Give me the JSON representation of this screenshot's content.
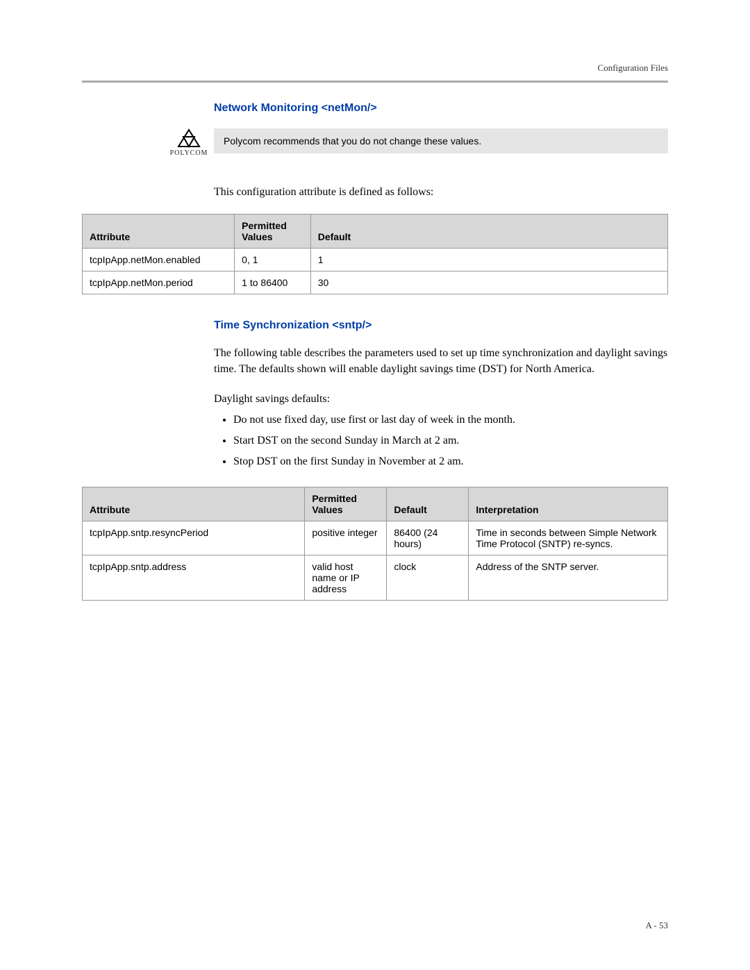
{
  "header": {
    "section": "Configuration Files"
  },
  "logo": {
    "text": "POLYCOM"
  },
  "netmon": {
    "heading": "Network Monitoring <netMon/>",
    "note": "Polycom recommends that you do not change these values.",
    "intro": "This configuration attribute is defined as follows:",
    "th": {
      "attr": "Attribute",
      "perm": "Permitted Values",
      "def": "Default"
    },
    "rows": [
      {
        "attr": "tcpIpApp.netMon.enabled",
        "perm": "0, 1",
        "def": "1"
      },
      {
        "attr": "tcpIpApp.netMon.period",
        "perm": "1 to 86400",
        "def": "30"
      }
    ]
  },
  "sntp": {
    "heading": "Time Synchronization <sntp/>",
    "intro": "The following table describes the parameters used to set up time synchronization and daylight savings time. The defaults shown will enable daylight savings time (DST) for North America.",
    "defaults_label": "Daylight savings defaults:",
    "bullets": [
      "Do not use fixed day, use first or last day of week in the month.",
      "Start DST on the second Sunday in March at 2 am.",
      "Stop DST on the first Sunday in November at 2 am."
    ],
    "th": {
      "attr": "Attribute",
      "perm": "Permitted Values",
      "def": "Default",
      "interp": "Interpretation"
    },
    "rows": [
      {
        "attr": "tcpIpApp.sntp.resyncPeriod",
        "perm": "positive integer",
        "def": "86400 (24 hours)",
        "interp": "Time in seconds between Simple Network Time Protocol (SNTP) re-syncs."
      },
      {
        "attr": "tcpIpApp.sntp.address",
        "perm": "valid host name or IP address",
        "def": "clock",
        "interp": "Address of the SNTP server."
      }
    ]
  },
  "footer": {
    "page": "A - 53"
  }
}
